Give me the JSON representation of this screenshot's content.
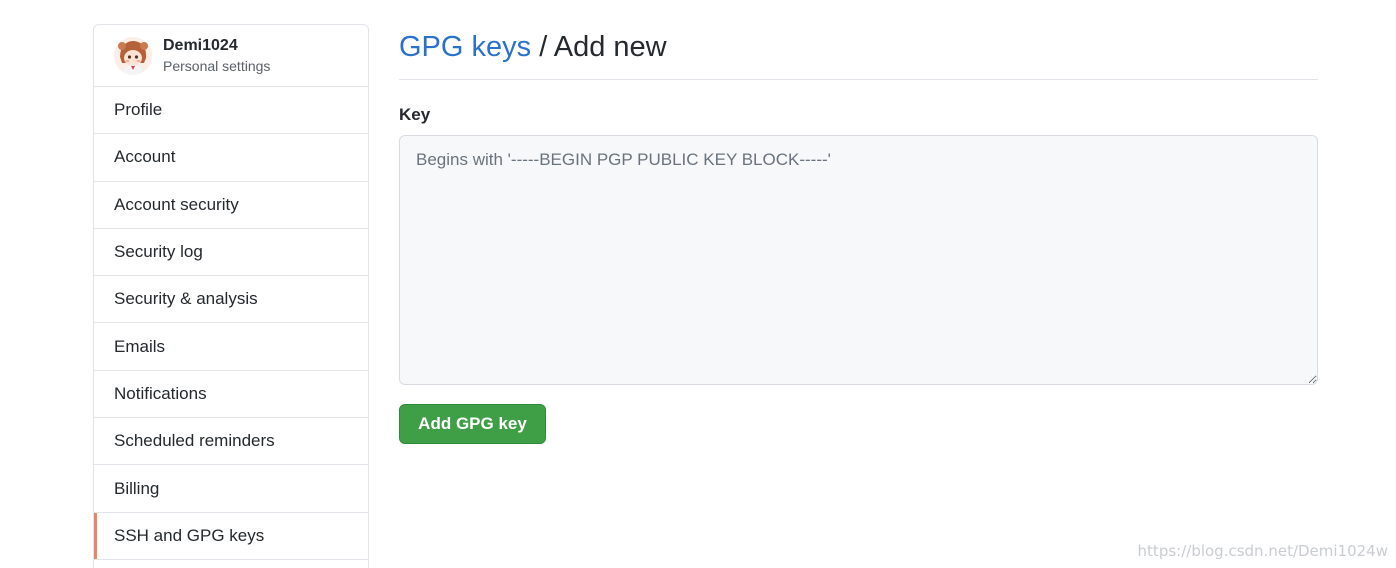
{
  "user": {
    "name": "Demi1024",
    "subtitle": "Personal settings"
  },
  "sidebar": {
    "items": [
      {
        "label": "Profile"
      },
      {
        "label": "Account"
      },
      {
        "label": "Account security"
      },
      {
        "label": "Security log"
      },
      {
        "label": "Security & analysis"
      },
      {
        "label": "Emails"
      },
      {
        "label": "Notifications"
      },
      {
        "label": "Scheduled reminders"
      },
      {
        "label": "Billing"
      },
      {
        "label": "SSH and GPG keys",
        "selected": true
      }
    ]
  },
  "header": {
    "link": "GPG keys",
    "separator": "/",
    "current": "Add new"
  },
  "form": {
    "key_label": "Key",
    "key_value": "",
    "key_placeholder": "Begins with '-----BEGIN PGP PUBLIC KEY BLOCK-----'",
    "submit_label": "Add GPG key"
  },
  "watermark": "https://blog.csdn.net/Demi1024w",
  "colors": {
    "link": "#2a71cc",
    "primary_button": "#3f9f47",
    "selected_indicator": "#e7846a"
  }
}
